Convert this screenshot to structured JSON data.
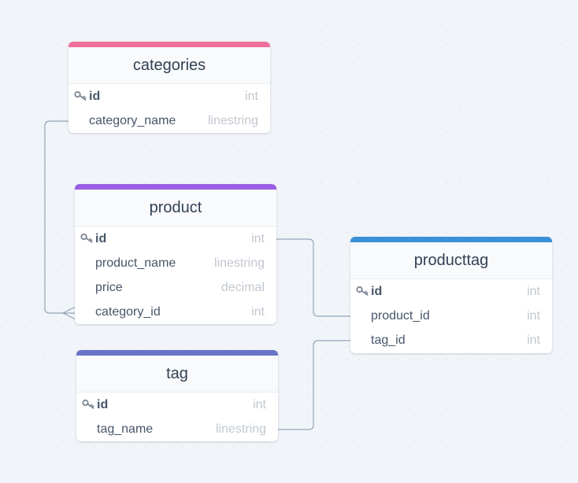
{
  "tables": {
    "categories": {
      "title": "categories",
      "accent_color": "#f06f9a",
      "fields": [
        {
          "name": "id",
          "type": "int",
          "primary_key": true
        },
        {
          "name": "category_name",
          "type": "linestring",
          "primary_key": false
        }
      ]
    },
    "product": {
      "title": "product",
      "accent_color": "#9b5de5",
      "fields": [
        {
          "name": "id",
          "type": "int",
          "primary_key": true
        },
        {
          "name": "product_name",
          "type": "linestring",
          "primary_key": false
        },
        {
          "name": "price",
          "type": "decimal",
          "primary_key": false
        },
        {
          "name": "category_id",
          "type": "int",
          "primary_key": false
        }
      ]
    },
    "productTag": {
      "title": "producttag",
      "accent_color": "#3a8fd6",
      "fields": [
        {
          "name": "id",
          "type": "int",
          "primary_key": true
        },
        {
          "name": "product_id",
          "type": "int",
          "primary_key": false
        },
        {
          "name": "tag_id",
          "type": "int",
          "primary_key": false
        }
      ]
    },
    "tag": {
      "title": "tag",
      "accent_color": "#6872c6",
      "fields": [
        {
          "name": "id",
          "type": "int",
          "primary_key": true
        },
        {
          "name": "tag_name",
          "type": "linestring",
          "primary_key": false
        }
      ]
    }
  },
  "relationships": [
    {
      "from": "categories.id",
      "to": "product.category_id",
      "cardinality": "one-to-many"
    },
    {
      "from": "product.id",
      "to": "producttag.product_id",
      "cardinality": "one-to-one"
    },
    {
      "from": "tag.id",
      "to": "producttag.tag_id",
      "cardinality": "one-to-one"
    }
  ],
  "colors": {
    "background": "#f1f5f9",
    "connector": "#94a3b8",
    "header_text": "#334155",
    "field_text": "#475569",
    "type_text": "#c2c8d0",
    "key_icon": "#7c8795"
  },
  "icons": {
    "primary_key": "key-icon"
  }
}
